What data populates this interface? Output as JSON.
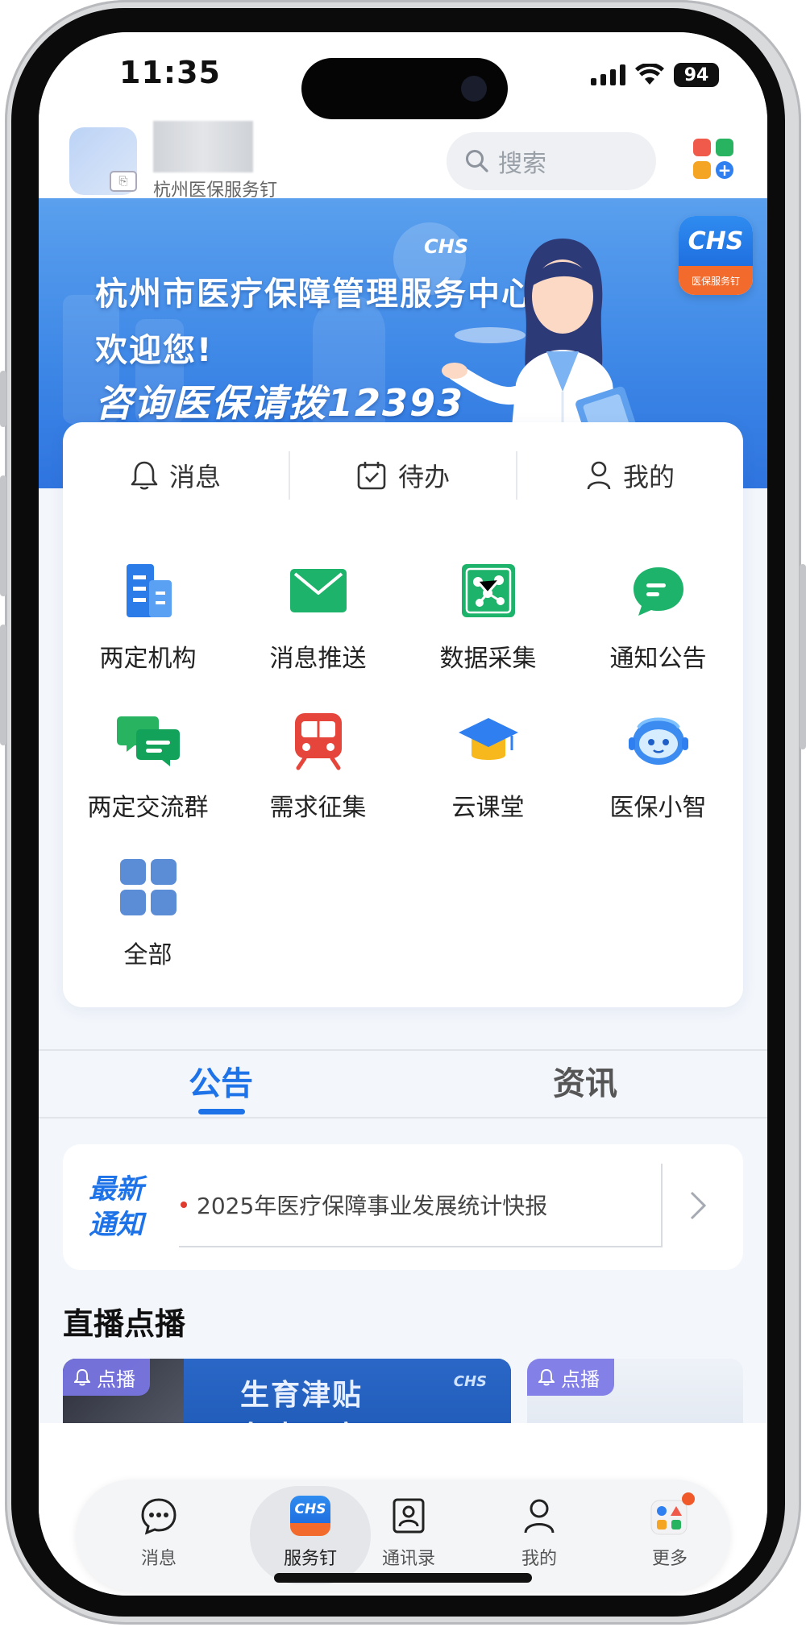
{
  "status_bar": {
    "time": "11:35",
    "battery": "94"
  },
  "header": {
    "org_subtitle": "杭州医保服务钉",
    "search_placeholder": "搜索"
  },
  "banner": {
    "chs_wordmark": "CHS",
    "line1": "杭州市医疗保障管理服务中心",
    "line2": "欢迎您!",
    "line3": "咨询医保请拨12393",
    "logo_text": "CHS",
    "logo_sub": "医保服务钉"
  },
  "quick_tabs": [
    {
      "label": "消息",
      "icon": "bell-icon"
    },
    {
      "label": "待办",
      "icon": "calendar-check-icon"
    },
    {
      "label": "我的",
      "icon": "person-icon"
    }
  ],
  "services": [
    {
      "label": "两定机构",
      "icon": "building-icon"
    },
    {
      "label": "消息推送",
      "icon": "envelope-icon"
    },
    {
      "label": "数据采集",
      "icon": "data-network-icon"
    },
    {
      "label": "通知公告",
      "icon": "chat-bubble-icon"
    },
    {
      "label": "两定交流群",
      "icon": "group-chat-icon"
    },
    {
      "label": "需求征集",
      "icon": "train-icon"
    },
    {
      "label": "云课堂",
      "icon": "graduation-cap-icon"
    },
    {
      "label": "医保小智",
      "icon": "robot-icon"
    },
    {
      "label": "全部",
      "icon": "grid-icon"
    }
  ],
  "news_tabs": {
    "active": "公告",
    "inactive": "资讯"
  },
  "notice": {
    "tag_line1": "最新",
    "tag_line2": "通知",
    "text": "2025年医疗保障事业发展统计快报"
  },
  "live": {
    "title": "直播点播",
    "cards": [
      {
        "badge": "点播",
        "image_text_1": "生育津贴",
        "image_text_2": "免申即享",
        "brand": "CHS"
      },
      {
        "badge": "点播"
      }
    ]
  },
  "bottom_nav": [
    {
      "label": "消息",
      "icon": "chat-dots-icon"
    },
    {
      "label": "服务钉",
      "icon": "chs-app-icon",
      "active": true,
      "icon_text": "CHS"
    },
    {
      "label": "通讯录",
      "icon": "contacts-icon"
    },
    {
      "label": "我的",
      "icon": "profile-icon"
    },
    {
      "label": "更多",
      "icon": "more-apps-icon"
    }
  ],
  "colors": {
    "accent": "#1e73e8",
    "banner": "#3c86e6",
    "green": "#1db36a",
    "orange": "#f36b2c",
    "notification_dot": "#e03b2f"
  }
}
